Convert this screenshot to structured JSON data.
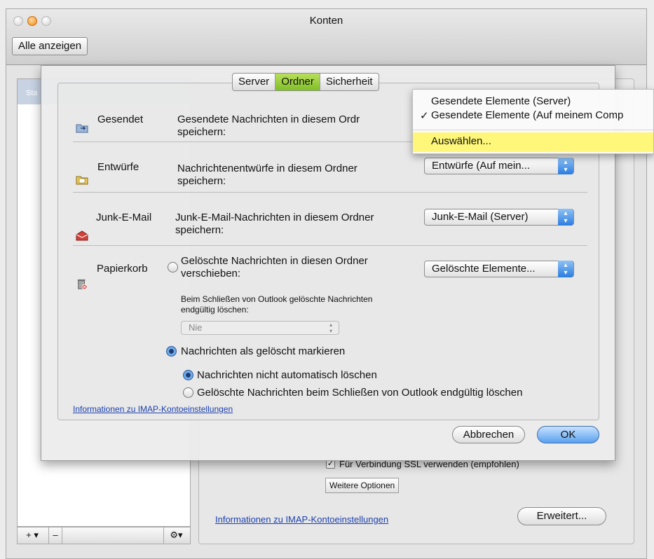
{
  "window": {
    "title": "Konten",
    "show_all_label": "Alle anzeigen"
  },
  "background": {
    "list_header": "Sta",
    "ssl_label": "Für Verbindung SSL verwenden (empfohlen)",
    "more_options": "Weitere Optionen",
    "imap_link": "Informationen zu IMAP-Kontoeinstellungen",
    "advanced_button": "Erweitert...",
    "add_label": "+ ▾",
    "remove_label": "–",
    "gear_label": "⚙▾"
  },
  "tabs": [
    {
      "label": "Server",
      "selected": false
    },
    {
      "label": "Ordner",
      "selected": true
    },
    {
      "label": "Sicherheit",
      "selected": false
    }
  ],
  "rows": {
    "sent": {
      "label": "Gesendet",
      "desc": "Gesendete Nachrichten in diesem Ordr speichern:"
    },
    "drafts": {
      "label": "Entwürfe",
      "desc": "Nachrichtenentwürfe in diesem Ordner speichern:",
      "popup": "Entwürfe (Auf mein..."
    },
    "junk": {
      "label": "Junk-E-Mail",
      "desc": "Junk-E-Mail-Nachrichten in diesem Ordner speichern:",
      "popup": "Junk-E-Mail (Server)"
    },
    "trash": {
      "label": "Papierkorb",
      "move_option": "Gelöschte Nachrichten in diesen Ordner verschieben:",
      "popup": "Gelöschte Elemente...",
      "on_close_label": "Beim Schließen von Outlook gelöschte Nachrichten endgültig löschen:",
      "on_close_popup": "Nie",
      "mark_option": "Nachrichten als gelöscht markieren",
      "no_auto_delete": "Nachrichten nicht automatisch löschen",
      "delete_on_close": "Gelöschte Nachrichten beim Schließen von Outlook endgültig löschen"
    }
  },
  "sheet": {
    "imap_link": "Informationen zu IMAP-Kontoeinstellungen",
    "cancel": "Abbrechen",
    "ok": "OK"
  },
  "menu": {
    "items": [
      "Gesendete Elemente (Server)",
      "Gesendete Elemente (Auf meinem Comp"
    ],
    "checked_index": 1,
    "check_mark": "✓",
    "choose": "Auswählen..."
  },
  "colors": {
    "tab_selected": "#8cc63f",
    "menu_highlight": "#fff77a",
    "link": "#1a3fb0"
  }
}
